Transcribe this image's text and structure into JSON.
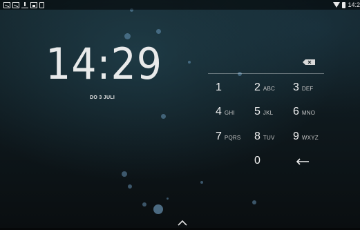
{
  "status_bar": {
    "time": "14:2",
    "icons": [
      "mail-icon",
      "mail-icon",
      "upload-icon",
      "image-icon",
      "device-icon"
    ],
    "right_icons": [
      "wifi-icon",
      "battery-icon"
    ]
  },
  "lockscreen": {
    "clock": "14:29",
    "date": "DO 3 JULI"
  },
  "keypad": {
    "keys": [
      {
        "num": "1",
        "letters": ""
      },
      {
        "num": "2",
        "letters": "ABC"
      },
      {
        "num": "3",
        "letters": "DEF"
      },
      {
        "num": "4",
        "letters": "GHI"
      },
      {
        "num": "5",
        "letters": "JKL"
      },
      {
        "num": "6",
        "letters": "MNO"
      },
      {
        "num": "7",
        "letters": "PQRS"
      },
      {
        "num": "8",
        "letters": "TUV"
      },
      {
        "num": "9",
        "letters": "WXYZ"
      },
      {
        "num": "0",
        "letters": ""
      }
    ]
  },
  "colors": {
    "background": "#0f1a1f",
    "text": "#ffffff"
  }
}
